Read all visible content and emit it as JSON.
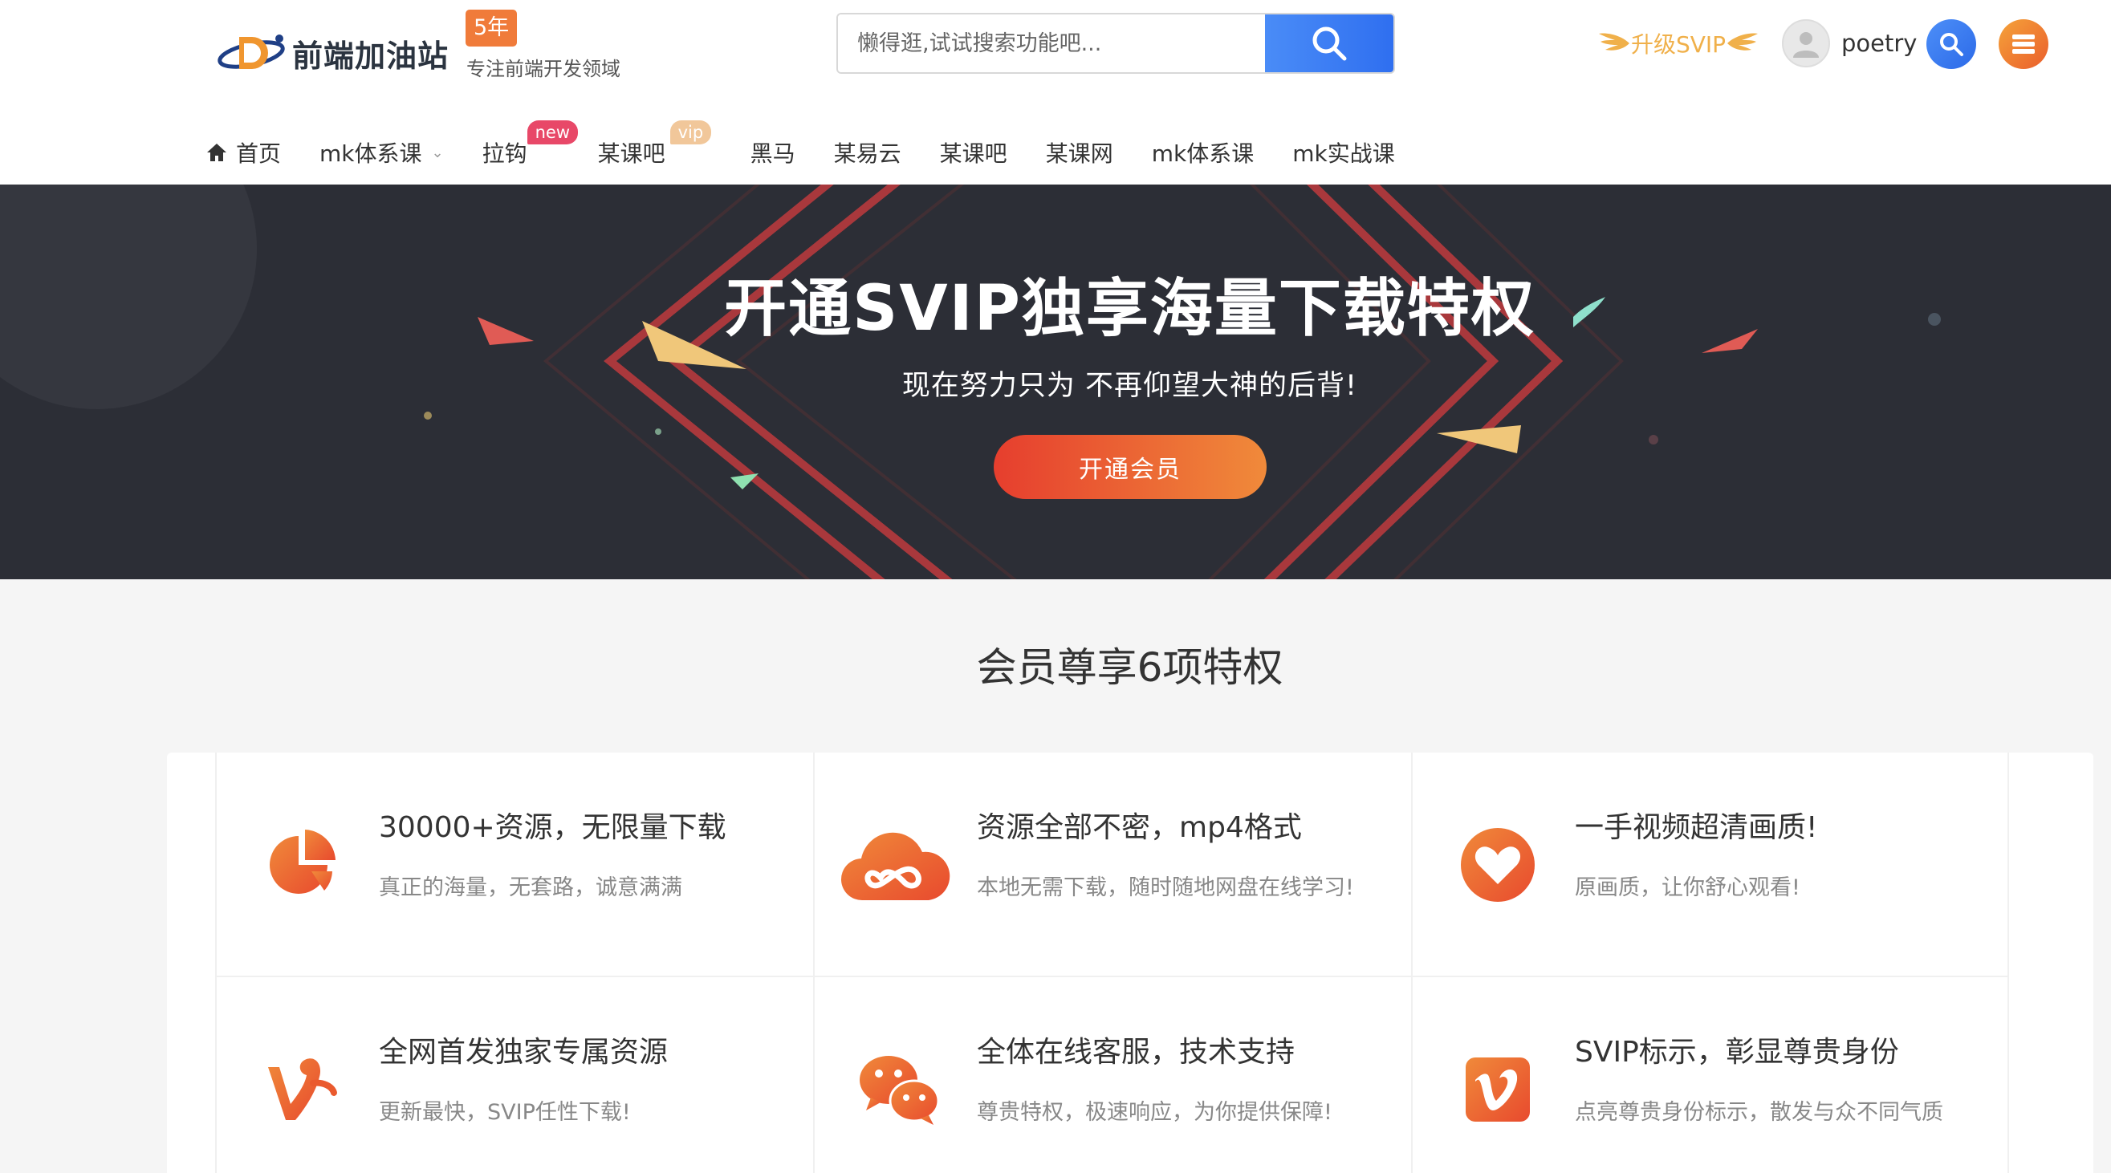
{
  "header": {
    "logo_text": "前端加油站",
    "badge": "5年",
    "tagline": "专注前端开发领域",
    "search": {
      "placeholder": "懒得逛,试试搜索功能吧..."
    },
    "svip_upgrade": "升级SVIP",
    "username": "poetry"
  },
  "nav": {
    "items": [
      {
        "label": "首页",
        "icon": "home-icon"
      },
      {
        "label": "mk体系课",
        "dropdown": true
      },
      {
        "label": "拉钩",
        "tag": "new"
      },
      {
        "label": "某课吧",
        "tag": "vip"
      },
      {
        "label": "黑马"
      },
      {
        "label": "某易云"
      },
      {
        "label": "某课吧"
      },
      {
        "label": "某课网"
      },
      {
        "label": "mk体系课"
      },
      {
        "label": "mk实战课"
      }
    ]
  },
  "banner": {
    "title": "开通SVIP独享海量下载特权",
    "subtitle": "现在努力只为 不再仰望大神的后背!",
    "button": "开通会员"
  },
  "benefits": {
    "title": "会员尊享6项特权",
    "items": [
      {
        "icon": "pie-chart-icon",
        "title": "30000+资源，无限量下载",
        "desc": "真正的海量，无套路，诚意满满"
      },
      {
        "icon": "cloud-infinity-icon",
        "title": "资源全部不密，mp4格式",
        "desc": "本地无需下载，随时随地网盘在线学习!"
      },
      {
        "icon": "heart-icon",
        "title": "一手视频超清画质!",
        "desc": "原画质，让你舒心观看!"
      },
      {
        "icon": "vine-icon",
        "title": "全网首发独家专属资源",
        "desc": "更新最快，SVIP任性下载!"
      },
      {
        "icon": "wechat-icon",
        "title": "全体在线客服，技术支持",
        "desc": "尊贵特权，极速响应，为你提供保障!"
      },
      {
        "icon": "vimeo-icon",
        "title": "SVIP标示，彰显尊贵身份",
        "desc": "点亮尊贵身份标示，散发与众不同气质"
      }
    ]
  },
  "colors": {
    "accent_orange": "#ee6a30",
    "search_blue": "#3478f5",
    "banner_bg": "#2c2e36",
    "gold": "#f0b04a"
  }
}
